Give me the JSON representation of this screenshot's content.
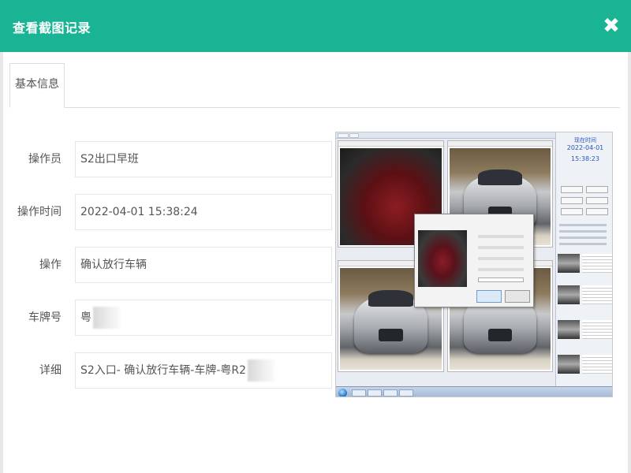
{
  "modal": {
    "title": "查看截图记录",
    "close_glyph": "✖"
  },
  "tabs": [
    {
      "label": "基本信息",
      "active": true
    }
  ],
  "form": {
    "operator_label": "操作员",
    "operator_value": "S2出口早班",
    "time_label": "操作时间",
    "time_value": "2022-04-01 15:38:24",
    "action_label": "操作",
    "action_value": "确认放行车辆",
    "plate_label": "车牌号",
    "plate_value": "粤",
    "detail_label": "详细",
    "detail_value": "S2入口- 确认放行车辆-车牌-粤R2"
  },
  "screenshot": {
    "clock_title": "现在时间",
    "clock_date": "2022-04-01",
    "clock_time": "15:38:23"
  },
  "colors": {
    "header": "#1ab394",
    "border": "#e5e6e7"
  },
  "icons": {
    "close": "close-icon"
  }
}
